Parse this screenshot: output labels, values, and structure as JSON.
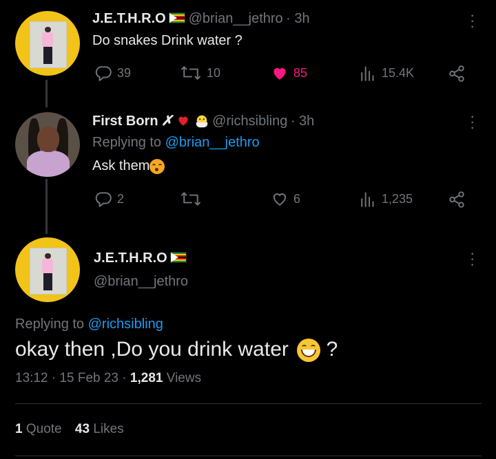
{
  "tweet1": {
    "name": "J.E.T.H.R.O",
    "handle": "@brian__jethro",
    "time": "· 3h",
    "text": "Do snakes Drink water ?",
    "replies": "39",
    "retweets": "10",
    "likes": "85",
    "views": "15.4K"
  },
  "tweet2": {
    "name": "First Born",
    "name_symbol": "✗",
    "handle": "@richsibling",
    "time": "· 3h",
    "replying_prefix": "Replying to",
    "replying_to": "@brian__jethro",
    "text": "Ask them",
    "replies": "2",
    "retweets": "",
    "likes": "6",
    "views": "1,235"
  },
  "main": {
    "name": "J.E.T.H.R.O",
    "handle": "@brian__jethro",
    "replying_prefix": "Replying to",
    "replying_to": "@richsibling",
    "text": "okay then ,Do you drink water",
    "text_suffix": "?",
    "time": "13:12",
    "date": "15 Feb 23",
    "views_count": "1,281",
    "views_label": "Views",
    "quotes_count": "1",
    "quotes_label": "Quote",
    "likes_count": "43",
    "likes_label": "Likes"
  },
  "colors": {
    "background": "#000000",
    "text": "#e7e9ea",
    "secondary": "#71767b",
    "link": "#1d9bf0",
    "like": "#f91880"
  },
  "icons": [
    "reply-icon",
    "retweet-icon",
    "heart-icon",
    "views-icon",
    "share-icon",
    "more-icon",
    "zimbabwe-flag-icon",
    "heart-emoji-icon",
    "chick-emoji-icon",
    "blushing-emoji-icon",
    "grinning-emoji-icon"
  ]
}
